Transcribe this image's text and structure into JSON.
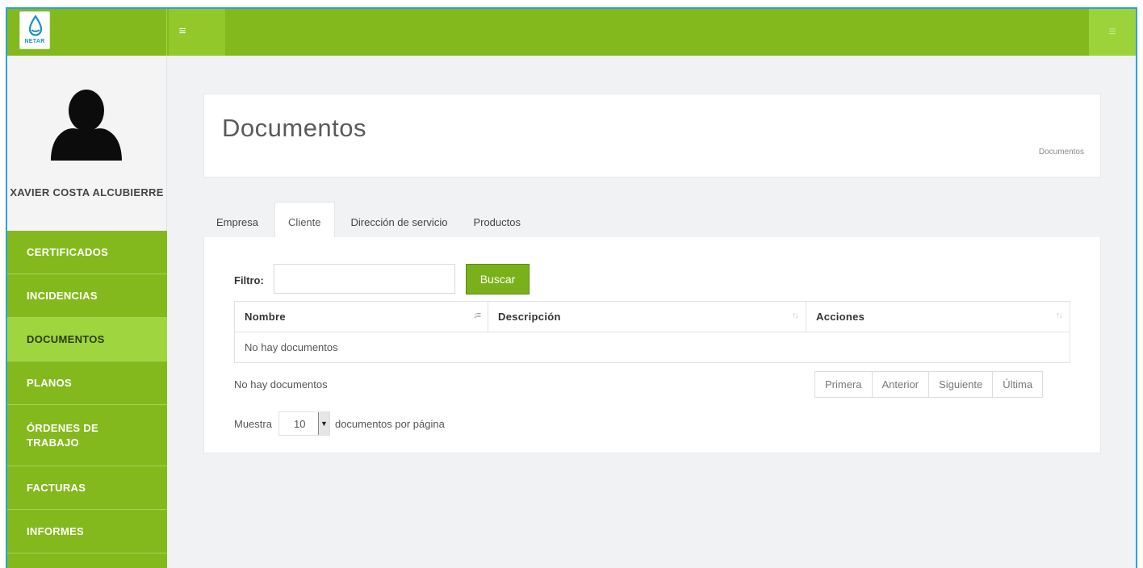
{
  "brand": {
    "logo_text": "NETAR"
  },
  "topbar": {
    "menu_icon": "hamburger-icon",
    "right_icon": "hamburger-icon"
  },
  "user": {
    "name": "XAVIER COSTA ALCUBIERRE",
    "avatar_icon": "user-silhouette-icon"
  },
  "sidebar": {
    "items": [
      {
        "label": "CERTIFICADOS"
      },
      {
        "label": "INCIDENCIAS"
      },
      {
        "label": "DOCUMENTOS",
        "active": true
      },
      {
        "label": "PLANOS"
      },
      {
        "label": "ÓRDENES DE TRABAJO"
      },
      {
        "label": "FACTURAS"
      },
      {
        "label": "INFORMES"
      }
    ]
  },
  "header": {
    "title": "Documentos",
    "breadcrumb": "Documentos"
  },
  "tabs": [
    {
      "label": "Empresa"
    },
    {
      "label": "Cliente",
      "active": true
    },
    {
      "label": "Dirección de servicio"
    },
    {
      "label": "Productos"
    }
  ],
  "filter": {
    "label": "Filtro:",
    "value": "",
    "button": "Buscar"
  },
  "table": {
    "columns": [
      "Nombre",
      "Descripción",
      "Acciones"
    ],
    "empty_message": "No hay documentos"
  },
  "info": "No hay documentos",
  "pagination": [
    "Primera",
    "Anterior",
    "Siguiente",
    "Última"
  ],
  "page_length": {
    "prefix": "Muestra",
    "value": "10",
    "suffix": "documentos por página"
  },
  "colors": {
    "brand_green": "#84b91e",
    "active_green": "#9fd63f",
    "frame_blue": "#2aa2dc"
  }
}
